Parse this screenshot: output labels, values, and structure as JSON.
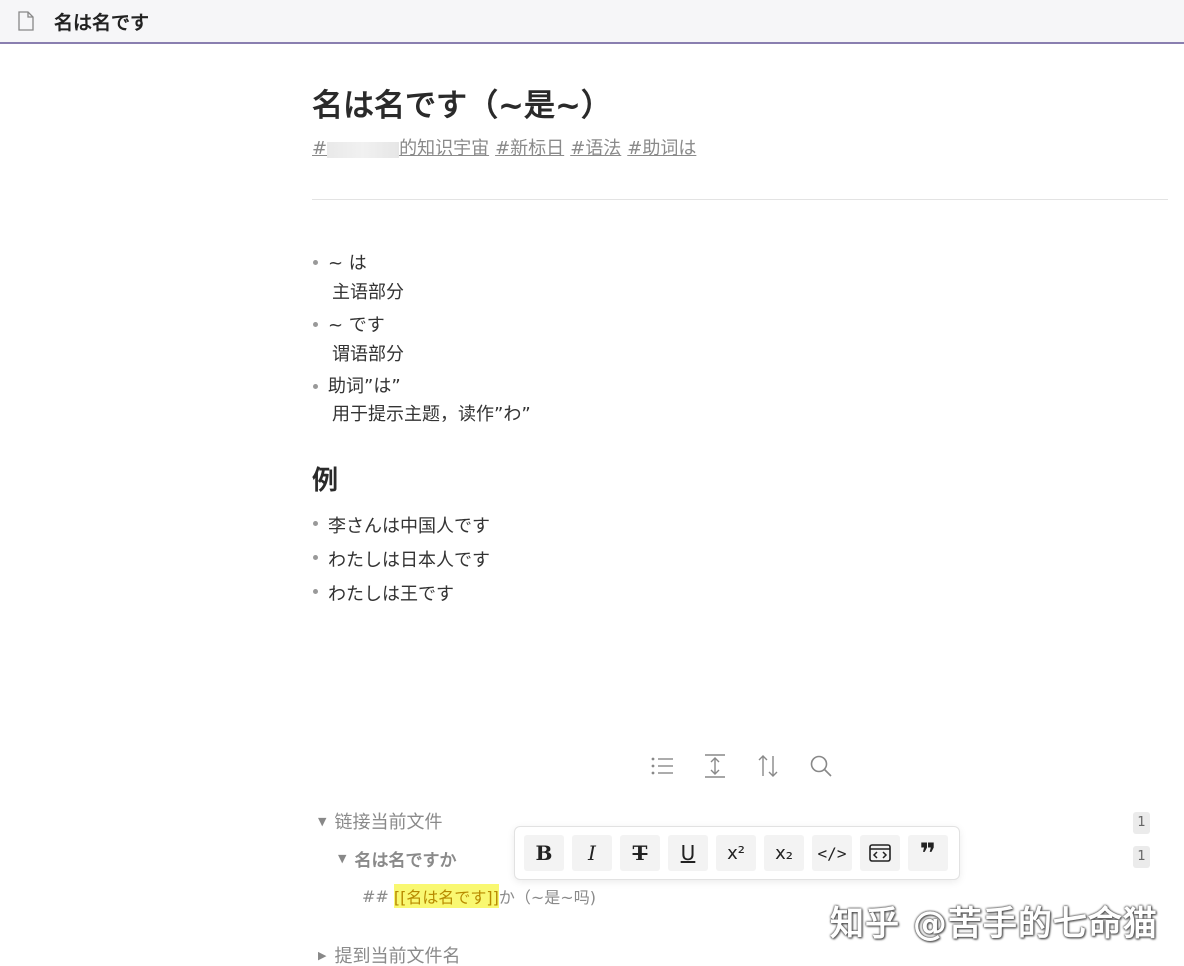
{
  "tab": {
    "title": "名は名です",
    "icon": "document-icon"
  },
  "page": {
    "title": "名は名です（~是~）",
    "tags": [
      "#",
      "的知识宇宙",
      "#新标日",
      "#语法",
      "#助词は"
    ]
  },
  "notes": [
    {
      "line1": "~ は",
      "line2": "主语部分"
    },
    {
      "line1": "~ です",
      "line2": "谓语部分"
    },
    {
      "line1": "助词”は”",
      "line2": "用于提示主题，读作”わ”"
    }
  ],
  "example": {
    "heading": "例",
    "items": [
      "李さんは中国人です",
      "わたしは日本人です",
      "わたしは王です"
    ]
  },
  "backlink_toolbar": {
    "icons": [
      "list-icon",
      "expand-vertical-icon",
      "sort-icon",
      "search-icon"
    ]
  },
  "backlinks": {
    "section_label": "链接当前文件",
    "section_count": "1",
    "file_label": "名は名ですか",
    "file_count": "1",
    "context_prefix": "## ",
    "context_link": "[[名は名です]]",
    "context_suffix": "か（~是~吗)",
    "mentions_label": "提到当前文件名"
  },
  "format_toolbar": {
    "buttons": [
      {
        "name": "bold",
        "label": "B"
      },
      {
        "name": "italic",
        "label": "I"
      },
      {
        "name": "strikethrough",
        "label": "T"
      },
      {
        "name": "underline",
        "label": "U"
      },
      {
        "name": "superscript",
        "label": "x²"
      },
      {
        "name": "subscript",
        "label": "x₂"
      },
      {
        "name": "code",
        "label": "</>"
      },
      {
        "name": "code-block",
        "label": "<>"
      },
      {
        "name": "quote",
        "label": "❞"
      }
    ]
  },
  "watermark": "知乎 @苦手的七命猫"
}
